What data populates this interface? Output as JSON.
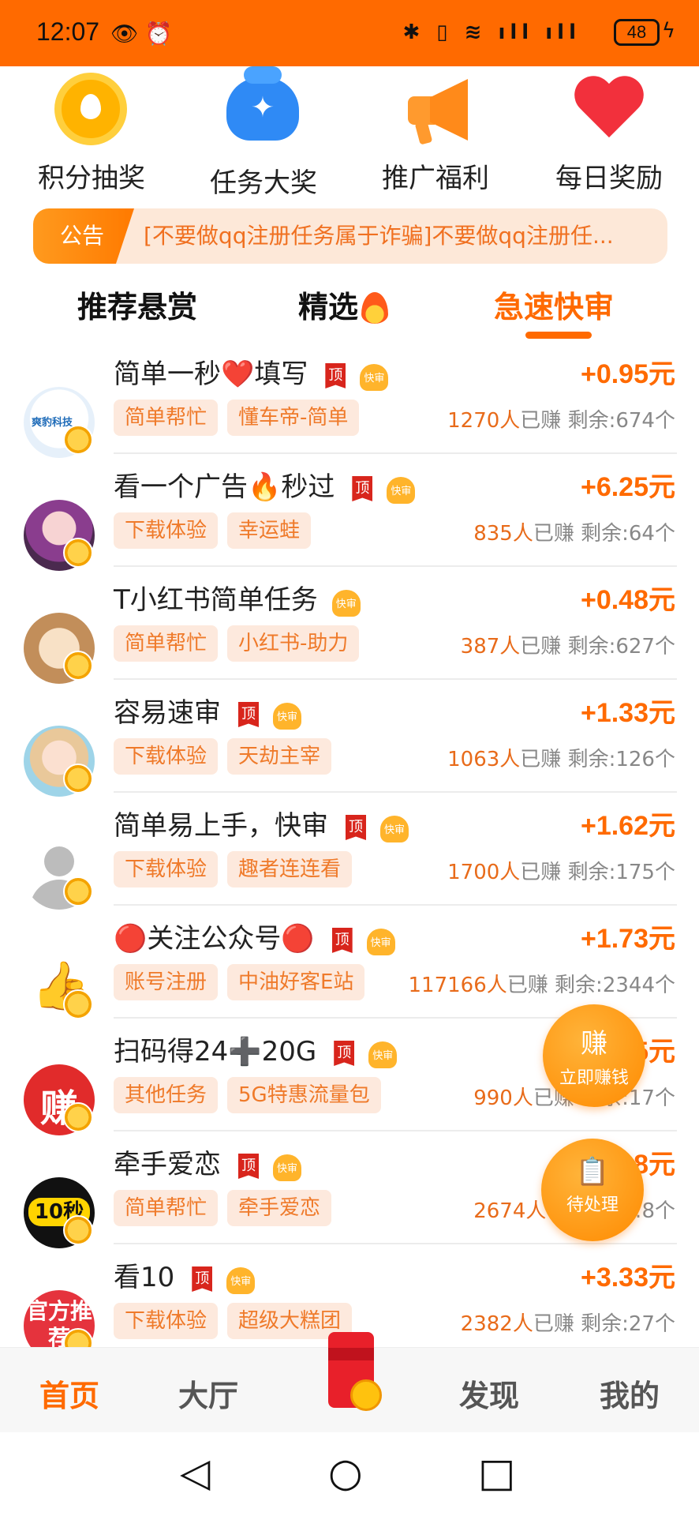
{
  "status_bar": {
    "time": "12:07",
    "battery": "48"
  },
  "quick_actions": [
    {
      "label": "积分抽奖",
      "icon": "coin-icon"
    },
    {
      "label": "任务大奖",
      "icon": "money-bag-icon"
    },
    {
      "label": "推广福利",
      "icon": "megaphone-icon"
    },
    {
      "label": "每日奖励",
      "icon": "heart-icon"
    }
  ],
  "notice": {
    "tag": "公告",
    "text": "[不要做qq注册任务属于诈骗]不要做qq注册任..."
  },
  "tabs": [
    {
      "label": "推荐悬赏",
      "active": false
    },
    {
      "label": "精选",
      "active": false
    },
    {
      "label": "急速快审",
      "active": true
    }
  ],
  "tag_labels": {
    "top": "顶",
    "fast": "快审",
    "earned_suffix": "已赚",
    "remaining_prefix": "剩余:",
    "remaining_suffix": "个"
  },
  "tasks": [
    {
      "title": "简单一秒❤️填写",
      "top": true,
      "price": "+0.95元",
      "category": "简单帮忙",
      "project": "懂车帝-简单",
      "earned": "1270人",
      "remaining": "674",
      "avatar_text": "爽豹科技"
    },
    {
      "title": "看一个广告🔥秒过",
      "top": true,
      "price": "+6.25元",
      "category": "下载体验",
      "project": "幸运蛙",
      "earned": "835人",
      "remaining": "64",
      "avatar_text": ""
    },
    {
      "title": "T小红书简单任务",
      "top": false,
      "price": "+0.48元",
      "category": "简单帮忙",
      "project": "小红书-助力",
      "earned": "387人",
      "remaining": "627",
      "avatar_text": ""
    },
    {
      "title": "容易速审",
      "top": true,
      "price": "+1.33元",
      "category": "下载体验",
      "project": "天劫主宰",
      "earned": "1063人",
      "remaining": "126",
      "avatar_text": ""
    },
    {
      "title": "简单易上手，快审",
      "top": true,
      "price": "+1.62元",
      "category": "下载体验",
      "project": "趣者连连看",
      "earned": "1700人",
      "remaining": "175",
      "avatar_text": ""
    },
    {
      "title": "🔴关注公众号🔴",
      "top": true,
      "price": "+1.73元",
      "category": "账号注册",
      "project": "中油好客E站",
      "earned": "117166人",
      "remaining": "2344",
      "avatar_text": "👍"
    },
    {
      "title": "扫码得24➕20G",
      "top": true,
      "price": "5元",
      "category": "其他任务",
      "project": "5G特惠流量包",
      "earned": "990人",
      "remaining": "17",
      "avatar_text": "赚"
    },
    {
      "title": "牵手爱恋",
      "top": true,
      "price": "8元",
      "category": "简单帮忙",
      "project": "牵手爱恋",
      "earned": "2674人",
      "remaining": "8",
      "avatar_text": "10秒"
    },
    {
      "title": "看10",
      "top": true,
      "price": "+3.33元",
      "category": "下载体验",
      "project": "超级大糕团",
      "earned": "2382人",
      "remaining": "27",
      "avatar_text": "官方推荐"
    }
  ],
  "floating": [
    {
      "label": "立即赚钱",
      "icon": "earn-icon",
      "glyph": "赚"
    },
    {
      "label": "待处理",
      "icon": "pending-icon",
      "glyph": "📋"
    }
  ],
  "bottom_nav": [
    {
      "label": "首页",
      "active": true
    },
    {
      "label": "大厅",
      "active": false
    },
    {
      "label": "发现",
      "active": false
    },
    {
      "label": "我的",
      "active": false
    }
  ],
  "colors": {
    "accent": "#ff6a00",
    "chip_bg": "#fde9dd",
    "notice_bg": "#fde8d8"
  }
}
